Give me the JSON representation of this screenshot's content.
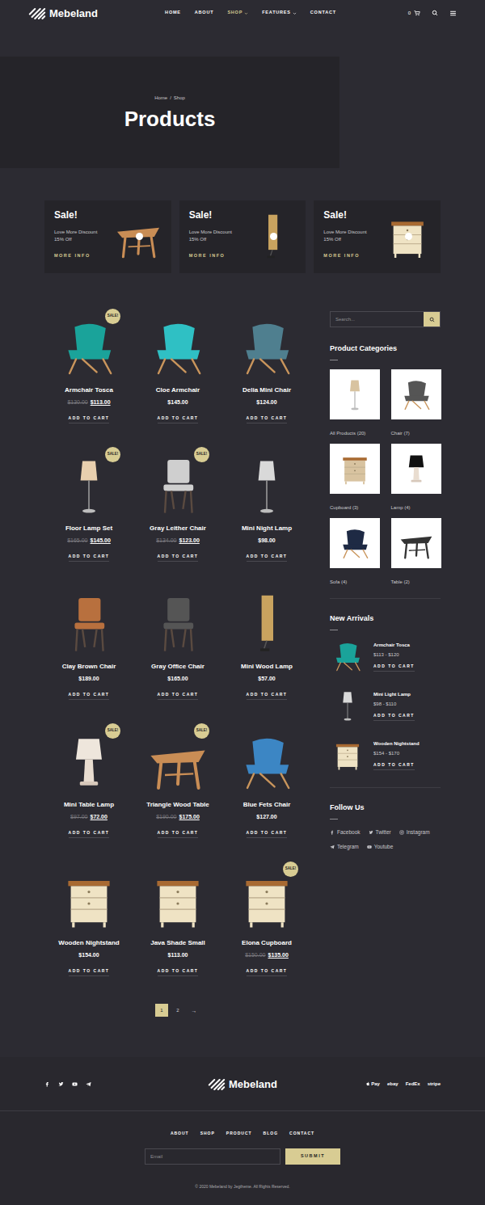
{
  "header": {
    "logo": "Mebeland",
    "nav": [
      {
        "label": "HOME",
        "selected": false,
        "dropdown": false
      },
      {
        "label": "ABOUT",
        "selected": false,
        "dropdown": false
      },
      {
        "label": "SHOP",
        "selected": true,
        "dropdown": true
      },
      {
        "label": "FEATURES",
        "selected": false,
        "dropdown": true
      },
      {
        "label": "CONTACT",
        "selected": false,
        "dropdown": false
      }
    ],
    "cart_count": "0"
  },
  "hero": {
    "breadcrumb": [
      "Home",
      "Shop"
    ],
    "separator": "/",
    "title": "Products"
  },
  "promos": [
    {
      "title": "Sale!",
      "line1": "Love More Discount",
      "line2": "15% Off",
      "link": "MORE INFO",
      "kind": "table",
      "color": "#c98d55"
    },
    {
      "title": "Sale!",
      "line1": "Love More Discount",
      "line2": "15% Off",
      "link": "MORE INFO",
      "kind": "wall-lamp",
      "color": "#c9a35f"
    },
    {
      "title": "Sale!",
      "line1": "Love More Discount",
      "line2": "15% Off",
      "link": "MORE INFO",
      "kind": "nightstand",
      "color": "#efe3c4"
    }
  ],
  "products": [
    {
      "name": "Armchair Tosca",
      "old_price": "$130.00",
      "price": "$113.00",
      "badge": "SALE!",
      "button": "ADD TO CART",
      "kind": "armchair",
      "color": "#1aa39a"
    },
    {
      "name": "Cloe Armchair",
      "old_price": null,
      "price": "$145.00",
      "badge": null,
      "button": "ADD TO CART",
      "kind": "armchair",
      "color": "#2fc0c4"
    },
    {
      "name": "Delia Mini Chair",
      "old_price": null,
      "price": "$124.00",
      "badge": null,
      "button": "ADD TO CART",
      "kind": "armchair",
      "color": "#4f7f8f"
    },
    {
      "name": "Floor Lamp Set",
      "old_price": "$165.00",
      "price": "$145.00",
      "badge": "SALE!",
      "button": "ADD TO CART",
      "kind": "floor-lamp",
      "color": "#e8cfae"
    },
    {
      "name": "Gray Leither Chair",
      "old_price": "$134.00",
      "price": "$123.00",
      "badge": "SALE!",
      "button": "ADD TO CART",
      "kind": "chair",
      "color": "#cfcfcf"
    },
    {
      "name": "Mini Night Lamp",
      "old_price": null,
      "price": "$98.00",
      "badge": null,
      "button": "ADD TO CART",
      "kind": "floor-lamp",
      "color": "#d9d9d9"
    },
    {
      "name": "Clay Brown Chair",
      "old_price": null,
      "price": "$189.00",
      "badge": null,
      "button": "ADD TO CART",
      "kind": "chair",
      "color": "#b8703e"
    },
    {
      "name": "Gray Office Chair",
      "old_price": null,
      "price": "$165.00",
      "badge": null,
      "button": "ADD TO CART",
      "kind": "chair",
      "color": "#555555"
    },
    {
      "name": "Mini Wood Lamp",
      "old_price": null,
      "price": "$57.00",
      "badge": null,
      "button": "ADD TO CART",
      "kind": "wall-lamp",
      "color": "#c9a35f"
    },
    {
      "name": "Mini Table Lamp",
      "old_price": "$97.00",
      "price": "$72.00",
      "badge": "SALE!",
      "button": "ADD TO CART",
      "kind": "table-lamp",
      "color": "#eee6dc"
    },
    {
      "name": "Triangle Wood Table",
      "old_price": "$190.00",
      "price": "$175.00",
      "badge": "SALE!",
      "button": "ADD TO CART",
      "kind": "table",
      "color": "#c98d55"
    },
    {
      "name": "Blue Fets Chair",
      "old_price": null,
      "price": "$127.00",
      "badge": null,
      "button": "ADD TO CART",
      "kind": "armchair",
      "color": "#3c86c4"
    },
    {
      "name": "Wooden Nightstand",
      "old_price": null,
      "price": "$154.00",
      "badge": null,
      "button": "ADD TO CART",
      "kind": "nightstand",
      "color": "#efe3c4"
    },
    {
      "name": "Java Shade Small",
      "old_price": null,
      "price": "$113.00",
      "badge": null,
      "button": "ADD TO CART",
      "kind": "nightstand",
      "color": "#efe3c4"
    },
    {
      "name": "Elona Cupboard",
      "old_price": "$150.00",
      "price": "$135.00",
      "badge": "SALE!",
      "button": "ADD TO CART",
      "kind": "nightstand",
      "color": "#efe3c4"
    }
  ],
  "pagination": {
    "pages": [
      {
        "label": "1",
        "selected": true
      },
      {
        "label": "2",
        "selected": false
      }
    ],
    "next": "→"
  },
  "sidebar": {
    "search": {
      "placeholder": "Search..."
    },
    "categories": {
      "title": "Product Categories",
      "items": [
        {
          "label": "All Products (20)",
          "kind": "floor-lamp",
          "color": "#d8c3a0"
        },
        {
          "label": "Chair (7)",
          "kind": "armchair",
          "color": "#555555"
        },
        {
          "label": "Cupboard (3)",
          "kind": "nightstand",
          "color": "#d8c3a0"
        },
        {
          "label": "Lamp (4)",
          "kind": "table-lamp",
          "color": "#111111"
        },
        {
          "label": "Sofa (4)",
          "kind": "armchair",
          "color": "#1e2a44"
        },
        {
          "label": "Table (2)",
          "kind": "table",
          "color": "#333333"
        }
      ]
    },
    "new_arrivals": {
      "title": "New Arrivals",
      "items": [
        {
          "name": "Armchair Tosca",
          "price": "$113 - $120",
          "button": "ADD TO CART",
          "kind": "armchair",
          "color": "#1aa39a"
        },
        {
          "name": "Mini Light Lamp",
          "price": "$98 - $110",
          "button": "ADD TO CART",
          "kind": "floor-lamp",
          "color": "#d9d9d9"
        },
        {
          "name": "Wooden Nightstand",
          "price": "$154 - $170",
          "button": "ADD TO CART",
          "kind": "nightstand",
          "color": "#efe3c4"
        }
      ]
    },
    "follow": {
      "title": "Follow Us",
      "links": [
        "Facebook",
        "Twitter",
        "Instagram",
        "Telegram",
        "Youtube"
      ]
    }
  },
  "footer": {
    "logo": "Mebeland",
    "payments": [
      "Pay",
      "ebay",
      "FedEx",
      "stripe"
    ],
    "nav": [
      "ABOUT",
      "SHOP",
      "PRODUCT",
      "BLOG",
      "CONTACT"
    ],
    "email_placeholder": "Email",
    "submit": "SUBMIT",
    "copyright": "© 2020 Mebeland by Jegtheme. All Rights Reserved."
  }
}
